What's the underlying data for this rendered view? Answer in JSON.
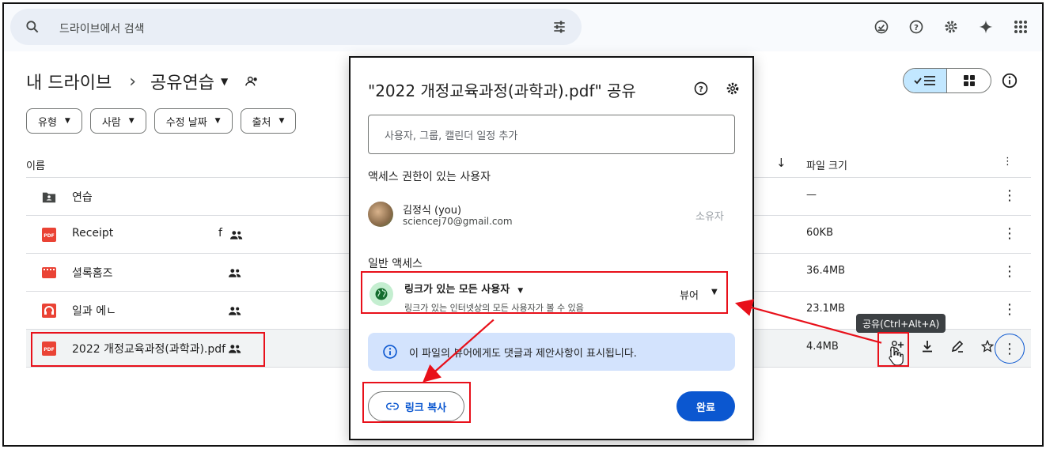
{
  "search": {
    "placeholder": "드라이브에서 검색"
  },
  "breadcrumb": {
    "root": "내 드라이브",
    "separator": "›",
    "current": "공유연습"
  },
  "filters": [
    "유형",
    "사람",
    "수정 날짜",
    "출처"
  ],
  "table": {
    "col_name": "이름",
    "col_size": "파일 크기",
    "rows": [
      {
        "name": "연습",
        "size": "—",
        "icon": "folder-icon"
      },
      {
        "name": "Receipt",
        "suffix": "f",
        "size": "60KB",
        "icon": "pdf-icon"
      },
      {
        "name": "셜록홈즈",
        "size": "36.4MB",
        "icon": "video-icon"
      },
      {
        "name": "일과 에ㄴ",
        "size": "23.1MB",
        "icon": "audio-icon"
      },
      {
        "name": "2022 개정교육과정(과학과).pdf",
        "size": "4.4MB",
        "icon": "pdf-icon"
      }
    ]
  },
  "tooltip": "공유(Ctrl+Alt+A)",
  "dialog": {
    "title": "\"2022 개정교육과정(과학과).pdf\" 공유",
    "input_placeholder": "사용자, 그룹, 캘린더 일정 추가",
    "access_section": "액세스 권한이 있는 사용자",
    "user": {
      "name": "김정식 (you)",
      "email": "sciencej70@gmail.com",
      "role": "소유자"
    },
    "general_section": "일반 액세스",
    "general": {
      "title": "링크가 있는 모든 사용자",
      "subtitle": "링크가 있는 인터넷상의 모든 사용자가 볼 수 있음",
      "role": "뷰어"
    },
    "info_text": "이 파일의 뷰어에게도 댓글과 제안사항이 표시됩니다.",
    "copy_link_label": "링크 복사",
    "done_label": "완료"
  },
  "colors": {
    "accent": "#0b57d0",
    "highlight": "#e8101a",
    "info_bg": "#d3e3fd",
    "selected_chip": "#c2e7ff"
  }
}
